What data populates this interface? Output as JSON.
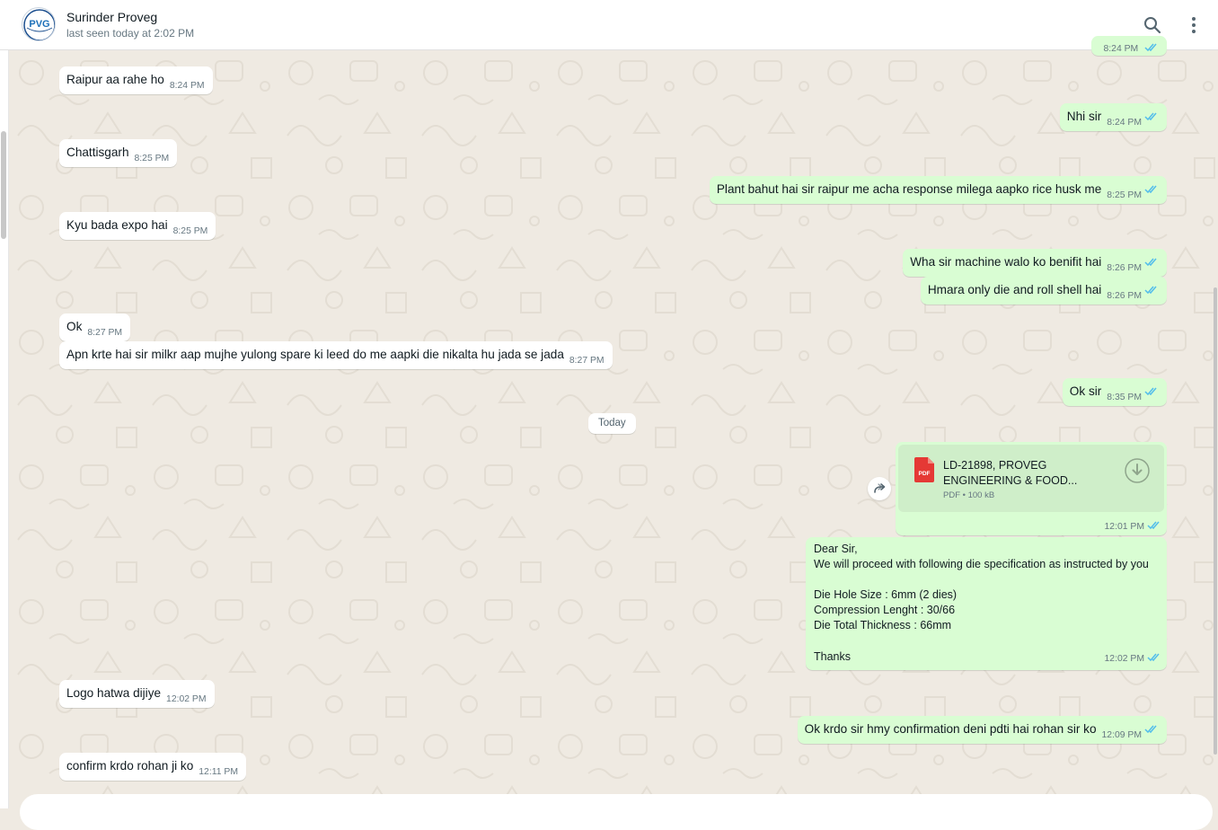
{
  "contact": {
    "name": "Surinder Proveg",
    "status": "last seen today at 2:02 PM",
    "avatar_text": "PVG"
  },
  "top_partial_time": "8:24 PM",
  "messages": [
    {
      "text": "Raipur aa rahe ho",
      "time": "8:24 PM"
    },
    {
      "text": "Nhi sir",
      "time": "8:24 PM"
    },
    {
      "text": "Chattisgarh",
      "time": "8:25 PM"
    },
    {
      "text": "Plant bahut hai sir raipur me acha response milega aapko rice husk me",
      "time": "8:25 PM"
    },
    {
      "text": "Kyu bada expo hai",
      "time": "8:25 PM"
    },
    {
      "text": "Wha sir machine walo ko benifit hai",
      "time": "8:26 PM"
    },
    {
      "text": "Hmara only die and roll shell hai",
      "time": "8:26 PM"
    },
    {
      "text": "Ok",
      "time": "8:27 PM"
    },
    {
      "text": "Apn krte hai sir milkr aap mujhe yulong spare ki leed do me aapki die nikalta hu jada se jada",
      "time": "8:27 PM"
    },
    {
      "text": "Ok sir",
      "time": "8:35 PM"
    },
    {
      "text": "Logo hatwa dijiye",
      "time": "12:02 PM"
    },
    {
      "text": "Ok krdo sir hmy confirmation deni pdti hai rohan sir ko",
      "time": "12:09 PM"
    },
    {
      "text": "confirm krdo rohan ji ko",
      "time": "12:11 PM"
    }
  ],
  "date_divider": "Today",
  "document": {
    "icon_label": "PDF",
    "name_line1": "LD-21898, PROVEG",
    "name_line2": "ENGINEERING & FOOD...",
    "info": "PDF • 100 kB",
    "time": "12:01 PM"
  },
  "spec_message": {
    "lines": [
      "Dear Sir,",
      "We will proceed with following die specification as instructed by you",
      "",
      "Die Hole Size : 6mm (2 dies)",
      "Compression Lenght : 30/66",
      "Die Total Thickness : 66mm",
      "",
      "Thanks"
    ],
    "time": "12:02 PM"
  },
  "colors": {
    "outgoing": "#d9fdd3",
    "incoming": "#ffffff",
    "background": "#efeae2",
    "read_ticks": "#53bdeb"
  }
}
